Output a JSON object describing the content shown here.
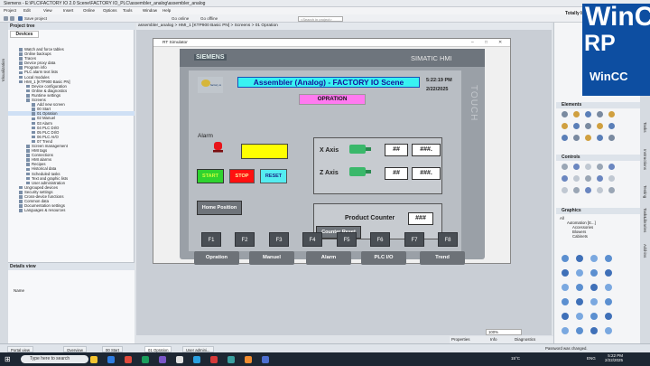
{
  "window": {
    "title": "Siemens - E:\\PLC\\FACTORY IO 2.0 Scene\\FACTORY IO_PLC\\assembler_analog\\assembler_analog"
  },
  "menubar": {
    "items": [
      "Project",
      "Edit",
      "View",
      "Insert",
      "Online",
      "Options",
      "Tools",
      "Window",
      "Help"
    ]
  },
  "toolbar": {
    "save_label": "Save project",
    "undo_label": "Go online",
    "offline_label": "Go offline",
    "search_placeholder": "<Search in project>"
  },
  "brand_right": "Totally Integrated Automation",
  "project_tree": {
    "header": "Project tree",
    "devices_tab": "Devices",
    "items": [
      {
        "label": "Watch and force tables",
        "selected": false
      },
      {
        "label": "Online backups",
        "selected": false
      },
      {
        "label": "Traces",
        "selected": false
      },
      {
        "label": "Device proxy data",
        "selected": false
      },
      {
        "label": "Program info",
        "selected": false
      },
      {
        "label": "PLC alarm text lists",
        "selected": false
      },
      {
        "label": "Local modules",
        "selected": false
      },
      {
        "label": "HMI_1 [KTP900 Basic PN]",
        "selected": false
      },
      {
        "label": "Device configuration",
        "selected": false
      },
      {
        "label": "Online & diagnostics",
        "selected": false
      },
      {
        "label": "Runtime settings",
        "selected": false
      },
      {
        "label": "Screens",
        "selected": false
      },
      {
        "label": "Add new screen",
        "selected": false
      },
      {
        "label": "00 Start",
        "selected": false
      },
      {
        "label": "01 Opration",
        "selected": true
      },
      {
        "label": "02 Manuel",
        "selected": false
      },
      {
        "label": "03 Alarm",
        "selected": false
      },
      {
        "label": "04 PLC DI/O",
        "selected": false
      },
      {
        "label": "05 PLC DI/O",
        "selected": false
      },
      {
        "label": "06 PLC AI/O",
        "selected": false
      },
      {
        "label": "07 Trend",
        "selected": false
      },
      {
        "label": "Screen management",
        "selected": false
      },
      {
        "label": "HMI tags",
        "selected": false
      },
      {
        "label": "Connections",
        "selected": false
      },
      {
        "label": "HMI alarms",
        "selected": false
      },
      {
        "label": "Recipes",
        "selected": false
      },
      {
        "label": "Historical data",
        "selected": false
      },
      {
        "label": "Scheduled tasks",
        "selected": false
      },
      {
        "label": "Text and graphic lists",
        "selected": false
      },
      {
        "label": "User administration",
        "selected": false
      },
      {
        "label": "Ungrouped devices",
        "selected": false
      },
      {
        "label": "Security settings",
        "selected": false
      },
      {
        "label": "Cross-device functions",
        "selected": false
      },
      {
        "label": "Common data",
        "selected": false
      },
      {
        "label": "Documentation settings",
        "selected": false
      },
      {
        "label": "Languages & resources",
        "selected": false
      }
    ]
  },
  "details_view": {
    "header": "Details view",
    "name_col": "Name"
  },
  "breadcrumb": "assembler_analog  >  HMI_1 [KTP900 Basic PN]  >  Screens  >  01 Opration",
  "simulator": {
    "title": "RT Simulator",
    "brand": "SIEMENS",
    "model": "SIMATIC HMI",
    "touch": "TOUCH",
    "logo_text": "factory io",
    "scene_title": "Assembler (Analog) - FACTORY IO Scene",
    "time": "5:22:19 PM",
    "date": "2/22/2025",
    "screen_name": "OPRATION",
    "alarm_label": "Alarm",
    "start": "START",
    "stop": "STOP",
    "reset": "RESET",
    "home": "Home Position",
    "x_axis": "X Axis",
    "z_axis": "Z Axis",
    "io_short": "##",
    "io_long": "###.",
    "product_counter": "Product Counter",
    "counter_value": "###",
    "counter_reset": "Counter Reset",
    "nav": [
      "Opration",
      "Manuel",
      "Alarm",
      "PLC I/O",
      "Trend"
    ],
    "fkeys": [
      "F1",
      "F2",
      "F3",
      "F4",
      "F5",
      "F6",
      "F7",
      "F8"
    ]
  },
  "right_panel": {
    "brand": [
      "WinC",
      "RP",
      "WinCC"
    ],
    "elements": "Elements",
    "controls": "Controls",
    "graphics": "Graphics",
    "graphics_tree": [
      "All",
      "Automation [E...]",
      "Accessories",
      "Blowers",
      "Cabinets"
    ],
    "strip": [
      "Tasks",
      "Instructions",
      "Testing",
      "Tasks",
      "Libraries",
      "Add-ins"
    ]
  },
  "status": {
    "zoom": "100%",
    "properties": "Properties",
    "info": "Info",
    "diagnostics": "Diagnostics",
    "message": "Password was changed."
  },
  "portal_tabs": [
    "Portal view",
    "Overview",
    "00 Start",
    "01 Opration",
    "User admini..."
  ],
  "taskbar": {
    "search": "Type here to search",
    "weather": "15°C",
    "time": "5:22 PM",
    "date": "2/22/2025",
    "lang": "ENG"
  }
}
